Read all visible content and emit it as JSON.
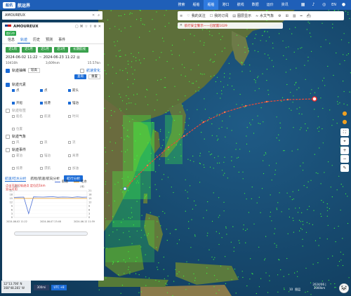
{
  "header": {
    "logo_text": "船讯",
    "brand": "航运界",
    "nav": [
      "搜索",
      "船舶",
      "船舶",
      "港口",
      "航线",
      "数据",
      "运价",
      "资讯"
    ],
    "nav_active_index": 2,
    "lang": "EN"
  },
  "search": {
    "value": "AMOUREUX"
  },
  "ship": {
    "name": "AMOUREUX",
    "status_badge": "航行中",
    "tabs": [
      "信息",
      "轨迹",
      "历史",
      "预测",
      "事件"
    ],
    "active_tab": 1
  },
  "range_buttons": [
    "近1周",
    "近1月",
    "近1月",
    "近3月",
    "长期航线"
  ],
  "dates": {
    "start": "2024-06-02",
    "start_time": "11:22",
    "sep": "~",
    "end": "2024-06-23",
    "end_time": "11:22"
  },
  "stats": {
    "a": "10410h",
    "b": "3,609nm",
    "c": "15.57kn"
  },
  "track_control": {
    "label": "轨迹抽稀",
    "select": "较高",
    "query": "查询",
    "reset": "重置"
  },
  "voyage_change": "航速变化",
  "track_elements": {
    "label": "轨迹元素",
    "items": [
      "点",
      "点",
      "箭头",
      "开船",
      "抵港",
      "锚泊"
    ]
  },
  "track_state": {
    "label": "轨迹标签",
    "items": [
      "船名",
      "航速",
      "时间",
      "位置"
    ]
  },
  "weather": {
    "label": "轨迹气象",
    "items": [
      "风",
      "浪",
      "流"
    ]
  },
  "events": {
    "label": "轨迹事件",
    "items": [
      "靠泊",
      "锚泊",
      "离港",
      "抵港",
      "漂航",
      "加油"
    ]
  },
  "bottom_tabs": {
    "tab1": "航速/吃水分析",
    "tab2": "航程/航速/航向分析",
    "button": "航行分析"
  },
  "chart_note": "点击可定位轨迹点 定位后1km显示可用",
  "chart_data": {
    "type": "line",
    "series": [
      {
        "name": "航速",
        "color": "#4a6fd6",
        "values": [
          15.8,
          15.9,
          16.0,
          3.0,
          16.2,
          16.1,
          16.0,
          16.2,
          16.3,
          15.9,
          16.1,
          16.0,
          15.8,
          16.2,
          15.9,
          16.0
        ]
      },
      {
        "name": "吃水",
        "color": "#e89a20",
        "values": [
          15.0,
          15.0,
          15.0,
          15.0,
          15.0,
          15.0,
          15.0,
          15.0,
          15.0,
          15.0,
          15.0,
          15.0,
          15.0,
          15.0,
          15.0,
          15.0
        ]
      }
    ],
    "ylabel_left": "(节)",
    "ylabel_right": "(米)",
    "y_left_ticks": [
      "21",
      "18",
      "15",
      "12",
      "9",
      "6",
      "3",
      "0"
    ],
    "y_right_ticks": [
      "21",
      "18",
      "15",
      "12",
      "9",
      "6",
      "3",
      "0"
    ],
    "x_ticks": [
      "2024-06-02 11:22",
      "2024-06-07 23:48",
      "2024-06-12 11:59"
    ],
    "ylim": [
      0,
      21
    ]
  },
  "toolbar": {
    "items": [
      "我的关注",
      "我的订阅",
      "图层显示",
      "水文气象"
    ]
  },
  "alert": "航行安全警示——已配置1029",
  "coords": {
    "lat": "12°13.706' N",
    "lon": "168°48.281' W"
  },
  "scale": "300mi",
  "utc": "UTC +8",
  "status": {
    "a": "10",
    "b": "图层"
  },
  "scale_text": "2024/06 | 3000km"
}
